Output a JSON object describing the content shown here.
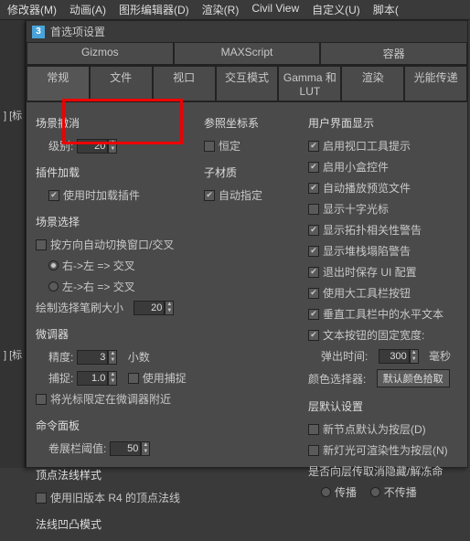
{
  "menubar": [
    "修改器(M)",
    "动画(A)",
    "图形编辑器(D)",
    "渲染(R)",
    "Civil View",
    "自定义(U)",
    "脚本("
  ],
  "left_marks": [
    "] [标",
    "] [标"
  ],
  "window": {
    "icon": "3",
    "title": "首选项设置"
  },
  "tabs1": [
    "Gizmos",
    "MAXScript",
    "容器"
  ],
  "tabs2": [
    "常规",
    "文件",
    "视口",
    "交互模式",
    "Gamma 和 LUT",
    "渲染",
    "光能传递"
  ],
  "leftcol": {
    "g1_title": "场景撤消",
    "g1_label": "级别:",
    "g1_val": "20",
    "g2_title": "插件加载",
    "g2_chk": "使用时加载插件",
    "g3_title": "场景选择",
    "g3_chk1": "按方向自动切换窗口/交叉",
    "g3_r1": "右->左 => 交叉",
    "g3_r2": "左->右 => 交叉",
    "g3_paint": "绘制选择笔刷大小",
    "g3_paint_val": "20",
    "g4_title": "微调器",
    "g4_prec": "精度:",
    "g4_prec_val": "3",
    "g4_prec_unit": "小数",
    "g4_snap": "捕捉:",
    "g4_snap_val": "1.0",
    "g4_snap_chk": "使用捕捉",
    "g4_chk2": "将光标限定在微调器附近",
    "g5_title": "命令面板",
    "g5_roll": "卷展栏阈值:",
    "g5_roll_val": "50",
    "g6_title": "顶点法线样式",
    "g6_chk": "使用旧版本 R4 的顶点法线",
    "g7_title": "法线凹凸模式"
  },
  "midcol": {
    "g1_title": "参照坐标系",
    "g1_chk": "恒定",
    "g2_title": "子材质",
    "g2_chk": "自动指定"
  },
  "rightcol": {
    "g1_title": "用户界面显示",
    "c1": "启用视口工具提示",
    "c2": "启用小盒控件",
    "c3": "自动播放预览文件",
    "c4": "显示十字光标",
    "c5": "显示拓扑相关性警告",
    "c6": "显示堆栈塌陷警告",
    "c7": "退出时保存 UI 配置",
    "c8": "使用大工具栏按钮",
    "c9": "垂直工具栏中的水平文本",
    "c10": "文本按钮的固定宽度:",
    "flytime": "弹出时间:",
    "flytime_val": "300",
    "flytime_unit": "毫秒",
    "colsel": "颜色选择器:",
    "colsel_btn": "默认颜色拾取",
    "g2_title": "层默认设置",
    "g2_c1": "新节点默认为按层(D)",
    "g2_c2": "新灯光可渲染性为按层(N)",
    "g2_c3": "是否向层传取消隐藏/解冻命",
    "g2_r1": "传播",
    "g2_r2": "不传播"
  }
}
